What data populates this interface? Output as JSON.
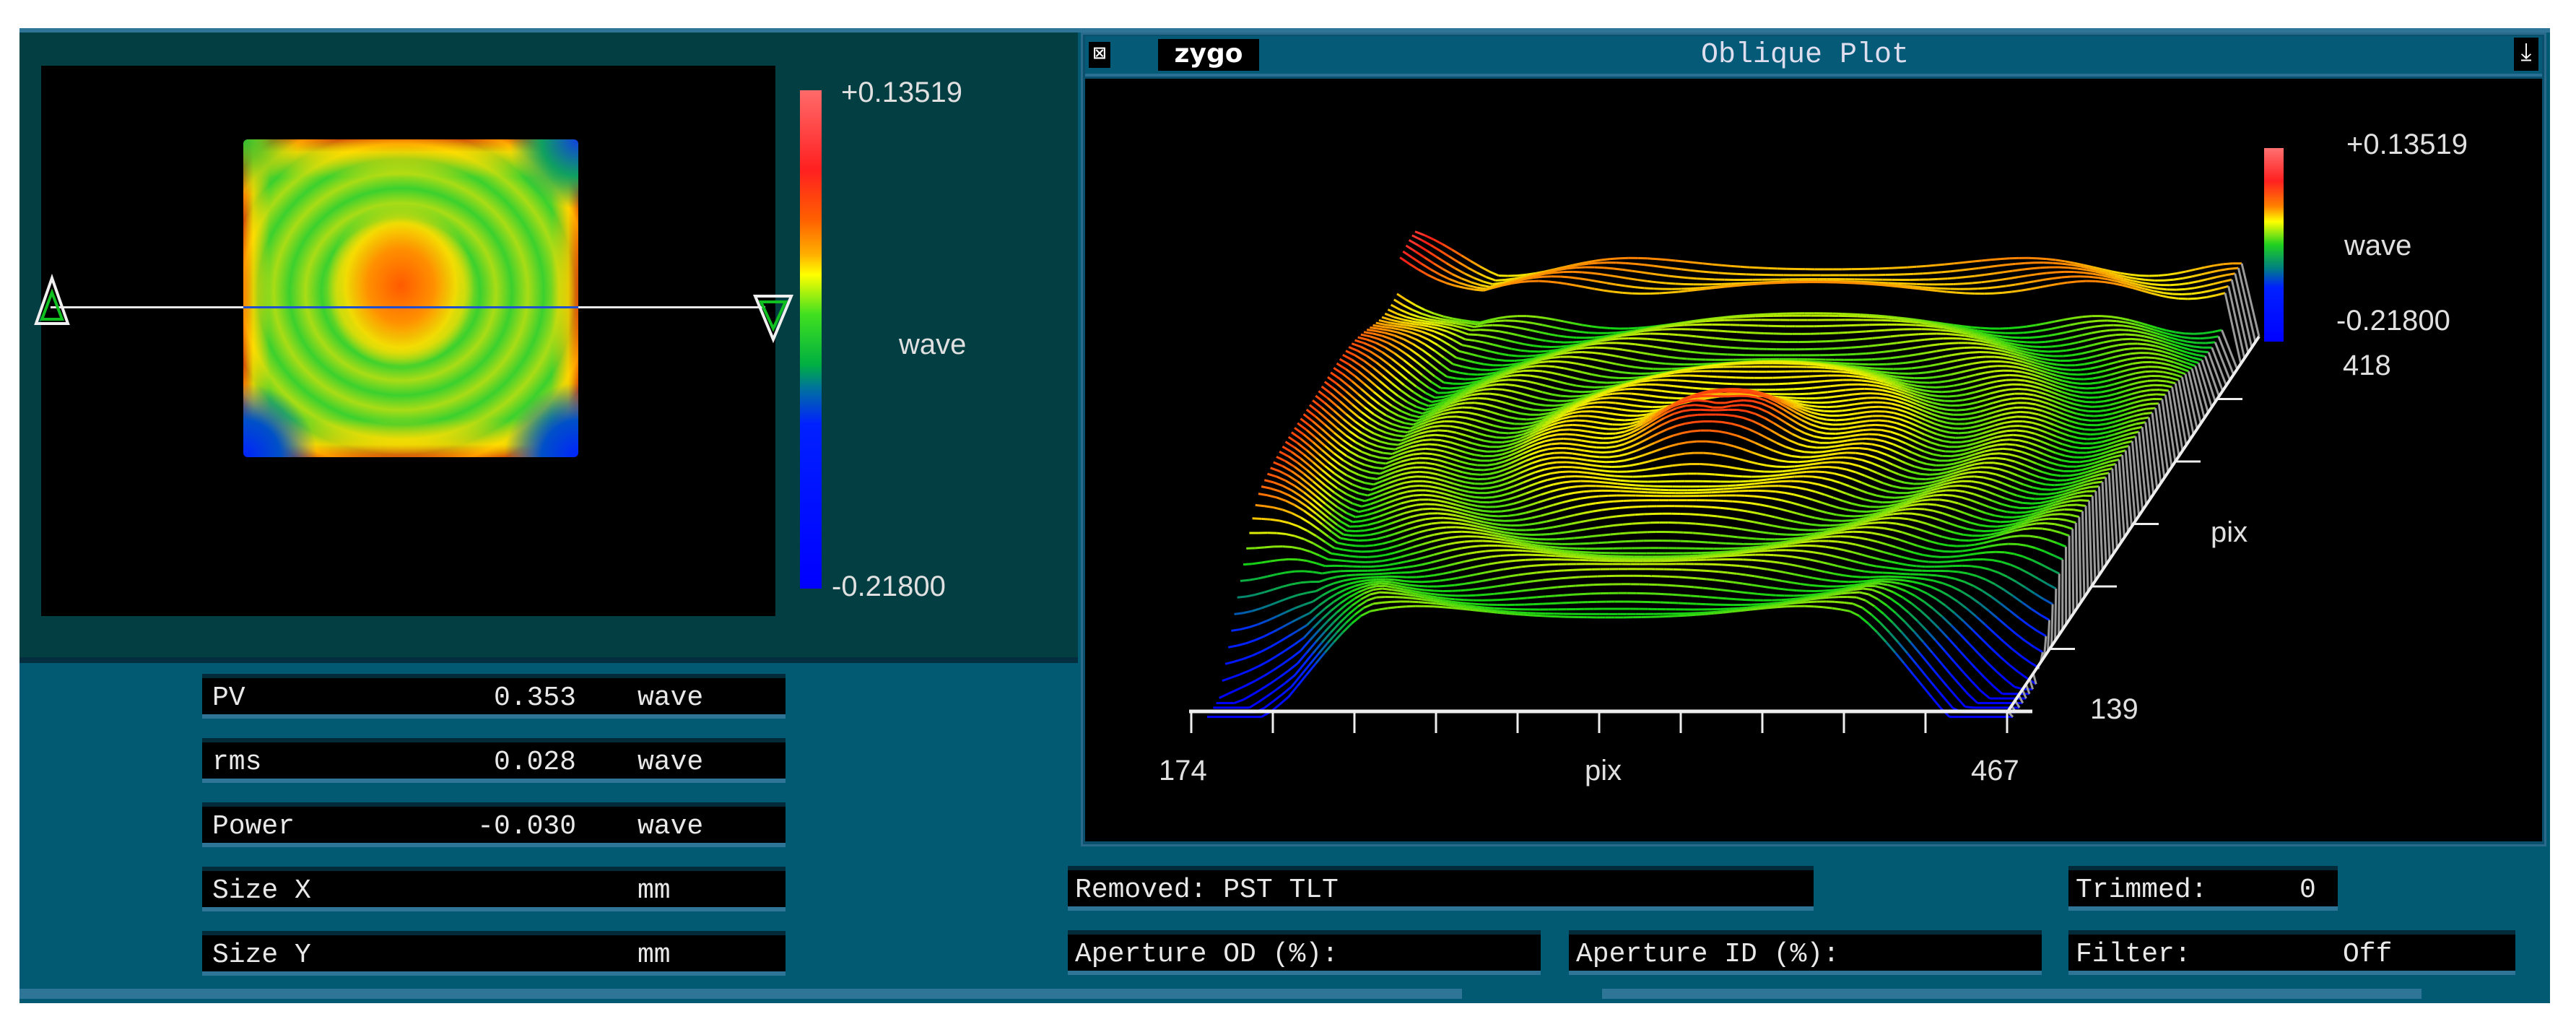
{
  "map_panel": {
    "colorbar": {
      "max_label": "+0.13519",
      "min_label": "-0.21800",
      "unit": "wave"
    }
  },
  "oblique_plot": {
    "title": "Oblique Plot",
    "logo": "zygo",
    "close_icon": "close-box-icon",
    "resize_icon": "window-resize-icon",
    "colorbar": {
      "max_label": "+0.13519",
      "min_label": "-0.21800",
      "unit": "wave"
    },
    "x_axis": {
      "min": "174",
      "max": "467",
      "label": "pix"
    },
    "y_axis": {
      "min": "139",
      "max": "418",
      "label": "pix"
    },
    "z_range": [
      -0.218,
      0.13519
    ]
  },
  "results": [
    {
      "label": "PV",
      "value": "0.353",
      "unit": "wave"
    },
    {
      "label": "rms",
      "value": "0.028",
      "unit": "wave"
    },
    {
      "label": "Power",
      "value": "-0.030",
      "unit": "wave"
    },
    {
      "label": "Size X",
      "value": "",
      "unit": "mm"
    },
    {
      "label": "Size Y",
      "value": "",
      "unit": "mm"
    }
  ],
  "status": {
    "removed": "Removed: PST TLT",
    "trimmed_label": "Trimmed:",
    "trimmed_value": "0",
    "aperture_od": "Aperture OD (%):",
    "aperture_id": "Aperture ID (%):",
    "filter_label": "Filter:",
    "filter_value": "Off"
  },
  "colors": {
    "panel": "#033e42",
    "frame": "#025a72",
    "accent": "#2f7597"
  }
}
